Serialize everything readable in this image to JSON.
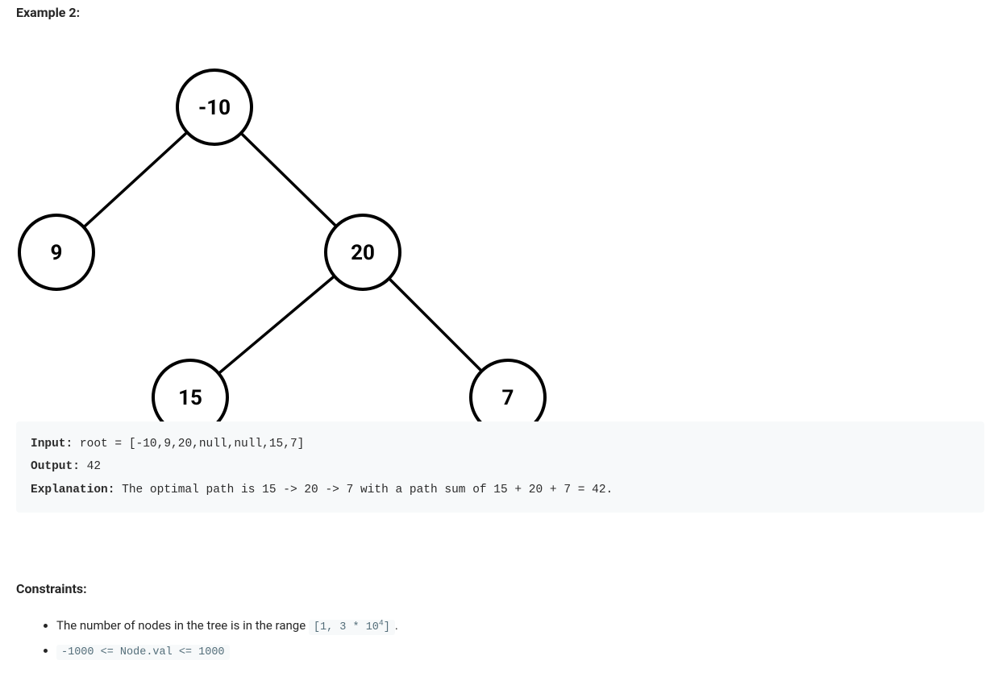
{
  "example_heading": "Example 2:",
  "tree": {
    "nodes": {
      "root": "-10",
      "left": "9",
      "right": "20",
      "right_left": "15",
      "right_right": "7"
    }
  },
  "code": {
    "input_label": "Input:",
    "input_value": " root = [-10,9,20,null,null,15,7]",
    "output_label": "Output:",
    "output_value": " 42",
    "explanation_label": "Explanation:",
    "explanation_value": " The optimal path is 15 -> 20 -> 7 with a path sum of 15 + 20 + 7 = 42."
  },
  "constraints_heading": "Constraints:",
  "constraints": {
    "item1_prefix": "The number of nodes in the tree is in the range ",
    "item1_code_a": "[1, 3 * 10",
    "item1_code_sup": "4",
    "item1_code_b": "]",
    "item1_suffix": ".",
    "item2_code": "-1000 <= Node.val <= 1000"
  }
}
